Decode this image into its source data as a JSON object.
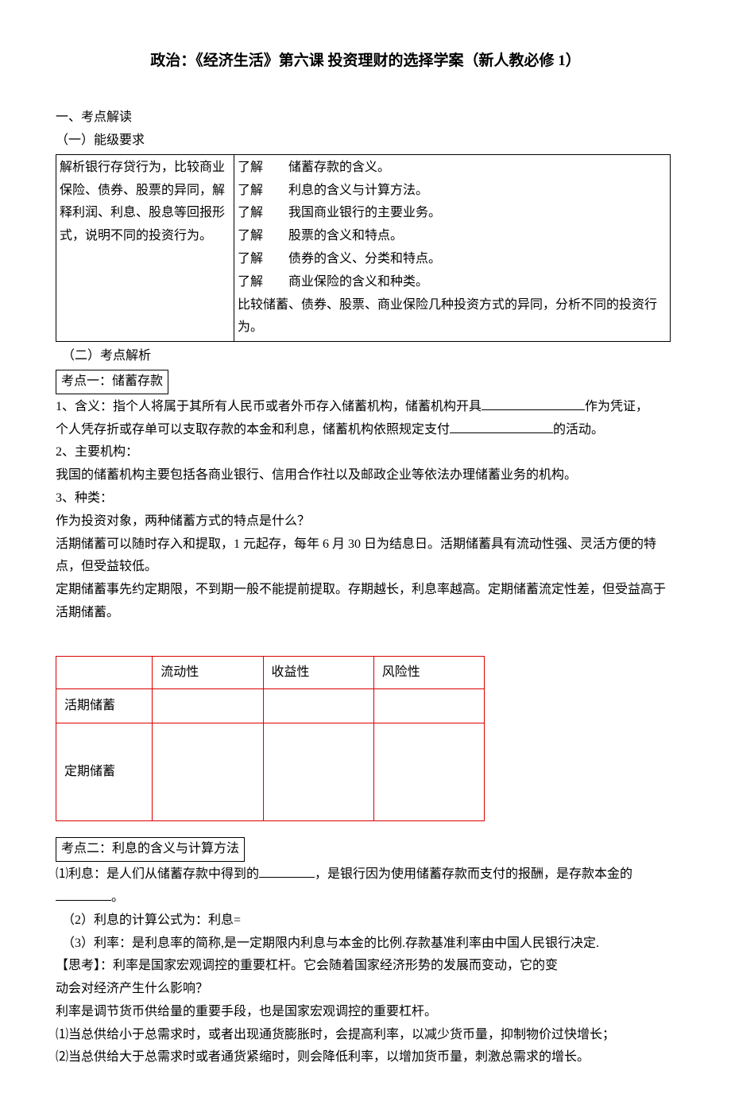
{
  "title": "政治：《经济生活》第六课 投资理财的选择学案（新人教必修 1）",
  "s1": "一、考点解读",
  "s1_1": "（一）能级要求",
  "table1": {
    "left": "解析银行存贷行为，比较商业保险、债券、股票的异同，解释利润、利息、股息等回报形式，说明不同的投资行为。",
    "right_lines": [
      "了解　　储蓄存款的含义。",
      "了解　　利息的含义与计算方法。",
      "了解　　我国商业银行的主要业务。",
      "了解　　股票的含义和特点。",
      "了解　　债券的含义、分类和特点。",
      "了解　　商业保险的含义和种类。",
      "比较储蓄、债券、股票、商业保险几种投资方式的异同，分析不同的投资行为。"
    ]
  },
  "s1_2": "（二）考点解析",
  "kp1_title": "考点一：储蓄存款",
  "kp1_1a": "1、含义：指个人将属于其所有人民币或者外币存入储蓄机构，储蓄机构开具",
  "kp1_1b": "作为凭证，",
  "kp1_1c": "个人凭存折或存单可以支取存款的本金和利息，储蓄机构依照规定支付",
  "kp1_1d": "的活动。",
  "kp1_2": "2、主要机构：",
  "kp1_2a": "我国的储蓄机构主要包括各商业银行、信用合作社以及邮政企业等依法办理储蓄业务的机构。",
  "kp1_3": "3、种类：",
  "kp1_3a": "作为投资对象，两种储蓄方式的特点是什么？",
  "kp1_3b": "活期储蓄可以随时存入和提取，1 元起存，每年 6 月 30 日为结息日。活期储蓄具有流动性强、灵活方便的特点，但受益较低。",
  "kp1_3c": "定期储蓄事先约定期限，不到期一般不能提前提取。存期越长，利息率越高。定期储蓄流定性差，但受益高于活期储蓄。",
  "table2": {
    "headers": [
      "",
      "流动性",
      "收益性",
      "风险性"
    ],
    "rows": [
      "活期储蓄",
      "定期储蓄"
    ]
  },
  "kp2_title": "考点二：利息的含义与计算方法",
  "kp2_1a": "⑴利息：是人们从储蓄存款中得到的",
  "kp2_1b": "，是银行因为使用储蓄存款而支付的报酬，是存款本金的",
  "kp2_1c": "。",
  "kp2_2": "（2）利息的计算公式为：利息=",
  "kp2_3": "（3）利率：是利息率的简称,是一定期限内利息与本金的比例.存款基准利率由中国人民银行决定.",
  "kp2_4a": "【思考】：利率是国家宏观调控的重要杠杆。它会随着国家经济形势的发展而变动，它的变",
  "kp2_4b": "动会对经济产生什么影响？",
  "kp2_5": "利率是调节货币供给量的重要手段，也是国家宏观调控的重要杠杆。",
  "kp2_6": "⑴当总供给小于总需求时，或者出现通货膨胀时，会提高利率，以减少货币量，抑制物价过快增长；",
  "kp2_7": "⑵当总供给大于总需求时或者通货紧缩时，则会降低利率，以增加货币量，刺激总需求的增长。"
}
